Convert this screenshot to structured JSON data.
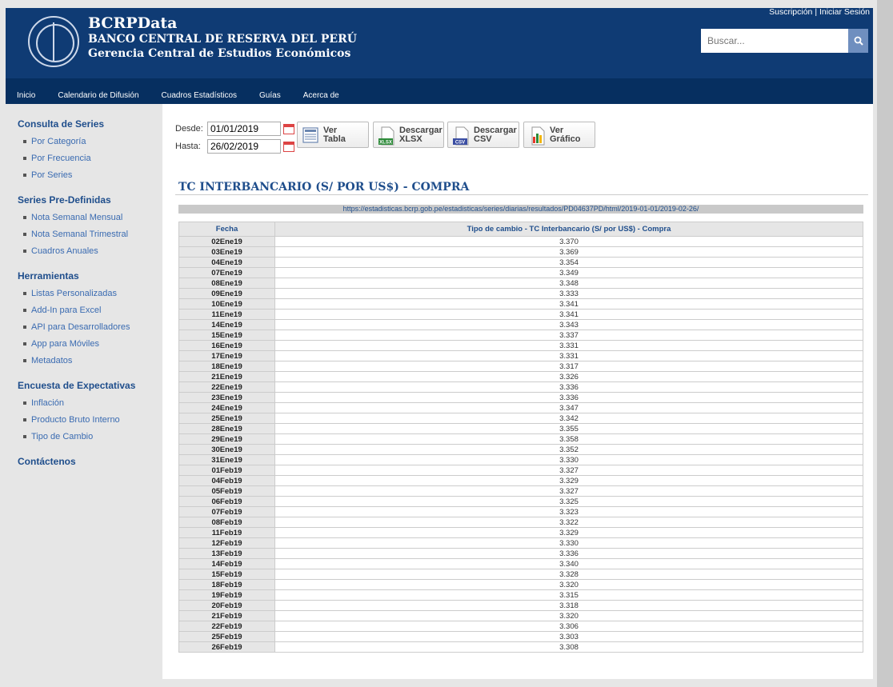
{
  "header": {
    "brand_title": "BCRPData",
    "brand_sub": "BANCO CENTRAL DE RESERVA DEL PERÚ",
    "brand_sub2": "Gerencia Central de Estudios Económicos",
    "link_subscribe": "Suscripción",
    "separator": " | ",
    "link_login": "Iniciar Sesión",
    "search_placeholder": "Buscar..."
  },
  "nav": [
    "Inicio",
    "Calendario de Difusión",
    "Cuadros Estadísticos",
    "Guías",
    "Acerca de"
  ],
  "sidebar": {
    "consulta": {
      "title": "Consulta de Series",
      "items": [
        "Por Categoría",
        "Por Frecuencia",
        "Por Series"
      ]
    },
    "predefinidas": {
      "title": "Series Pre-Definidas",
      "items": [
        "Nota Semanal Mensual",
        "Nota Semanal Trimestral",
        "Cuadros Anuales"
      ]
    },
    "herramientas": {
      "title": "Herramientas",
      "items": [
        "Listas Personalizadas",
        "Add-In para Excel",
        "API para Desarrolladores",
        "App para Móviles",
        "Metadatos"
      ]
    },
    "encuesta": {
      "title": "Encuesta de Expectativas",
      "items": [
        "Inflación",
        "Producto Bruto Interno",
        "Tipo de Cambio"
      ]
    },
    "contacto": "Contáctenos"
  },
  "controls": {
    "desde_label": "Desde:",
    "desde_value": "01/01/2019",
    "hasta_label": "Hasta:",
    "hasta_value": "26/02/2019",
    "btn_tabla": [
      "Ver",
      "Tabla"
    ],
    "btn_xlsx": [
      "Descargar",
      "XLSX"
    ],
    "btn_csv": [
      "Descargar",
      "CSV"
    ],
    "btn_grafico": [
      "Ver",
      "Gráfico"
    ],
    "xlsx_tag": "XLSX",
    "csv_tag": "CSV"
  },
  "series_title": "TC INTERBANCARIO (S/ POR US$) - COMPRA",
  "url": "https://estadisticas.bcrp.gob.pe/estadisticas/series/diarias/resultados/PD04637PD/html/2019-01-01/2019-02-26/",
  "table": {
    "headers": [
      "Fecha",
      "Tipo de cambio - TC Interbancario (S/ por US$) - Compra"
    ],
    "rows": [
      [
        "02Ene19",
        "3.370"
      ],
      [
        "03Ene19",
        "3.369"
      ],
      [
        "04Ene19",
        "3.354"
      ],
      [
        "07Ene19",
        "3.349"
      ],
      [
        "08Ene19",
        "3.348"
      ],
      [
        "09Ene19",
        "3.333"
      ],
      [
        "10Ene19",
        "3.341"
      ],
      [
        "11Ene19",
        "3.341"
      ],
      [
        "14Ene19",
        "3.343"
      ],
      [
        "15Ene19",
        "3.337"
      ],
      [
        "16Ene19",
        "3.331"
      ],
      [
        "17Ene19",
        "3.331"
      ],
      [
        "18Ene19",
        "3.317"
      ],
      [
        "21Ene19",
        "3.326"
      ],
      [
        "22Ene19",
        "3.336"
      ],
      [
        "23Ene19",
        "3.336"
      ],
      [
        "24Ene19",
        "3.347"
      ],
      [
        "25Ene19",
        "3.342"
      ],
      [
        "28Ene19",
        "3.355"
      ],
      [
        "29Ene19",
        "3.358"
      ],
      [
        "30Ene19",
        "3.352"
      ],
      [
        "31Ene19",
        "3.330"
      ],
      [
        "01Feb19",
        "3.327"
      ],
      [
        "04Feb19",
        "3.329"
      ],
      [
        "05Feb19",
        "3.327"
      ],
      [
        "06Feb19",
        "3.325"
      ],
      [
        "07Feb19",
        "3.323"
      ],
      [
        "08Feb19",
        "3.322"
      ],
      [
        "11Feb19",
        "3.329"
      ],
      [
        "12Feb19",
        "3.330"
      ],
      [
        "13Feb19",
        "3.336"
      ],
      [
        "14Feb19",
        "3.340"
      ],
      [
        "15Feb19",
        "3.328"
      ],
      [
        "18Feb19",
        "3.320"
      ],
      [
        "19Feb19",
        "3.315"
      ],
      [
        "20Feb19",
        "3.318"
      ],
      [
        "21Feb19",
        "3.320"
      ],
      [
        "22Feb19",
        "3.306"
      ],
      [
        "25Feb19",
        "3.303"
      ],
      [
        "26Feb19",
        "3.308"
      ]
    ]
  }
}
